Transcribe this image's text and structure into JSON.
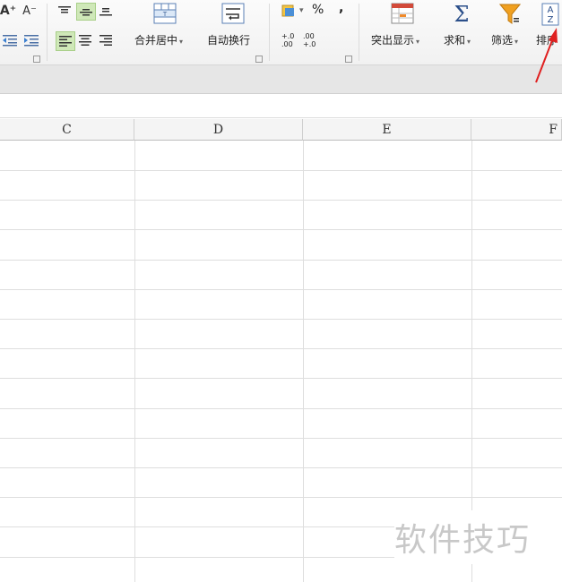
{
  "ribbon": {
    "font_grow_label": "A⁺",
    "font_shrink_label": "A⁻",
    "merge_center_label": "合并居中",
    "wrap_text_label": "自动换行",
    "percent_label": "%",
    "comma_label": ",",
    "inc_decimal_label": "+.0\n.00",
    "dec_decimal_label": ".00\n+.0",
    "highlight_label": "突出显示",
    "sum_label": "求和",
    "filter_label": "筛选",
    "sort_label": "排序",
    "dropdown_glyph": "▾"
  },
  "columns": [
    "C",
    "D",
    "E",
    "F"
  ],
  "watermark": "软件技巧",
  "colors": {
    "accent_green": "#cfe8b8",
    "filter_orange": "#f0a020",
    "annotation_red": "#e02020"
  }
}
